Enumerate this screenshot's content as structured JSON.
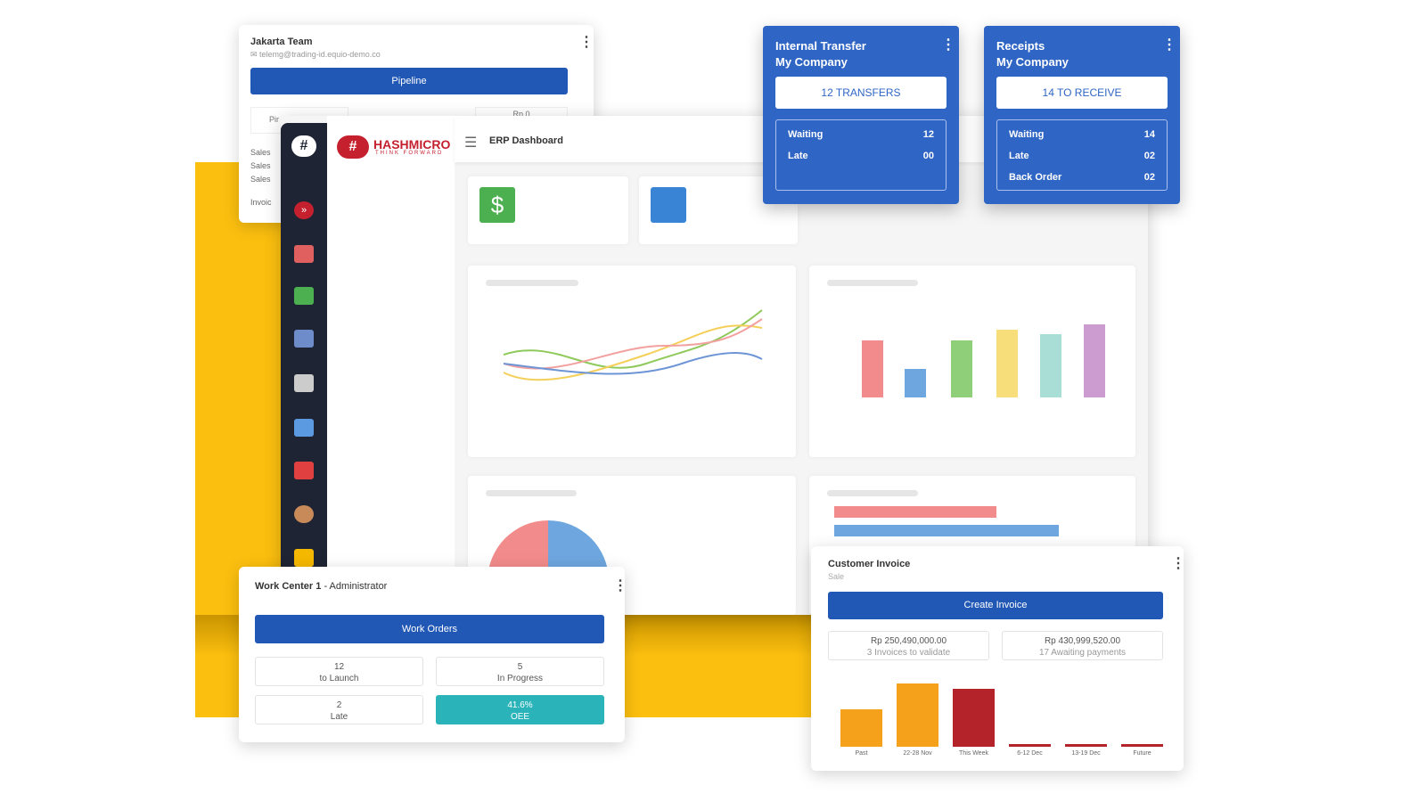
{
  "jakarta": {
    "title": "Jakarta Team",
    "email": "telemg@trading-id.equio-demo.co",
    "button": "Pipeline",
    "tab1": "Pir",
    "tab3": "Rp 0",
    "rows": [
      "Sales",
      "Sales",
      "Sales"
    ],
    "invoice": "Invoic"
  },
  "dashboard": {
    "brand": "HASHMICRO",
    "tagline": "THINK FORWARD",
    "title": "ERP Dashboard"
  },
  "transfer": {
    "title": "Internal Transfer",
    "company": "My Company",
    "button": "12 TRANSFERS",
    "rows": [
      {
        "label": "Waiting",
        "value": "12"
      },
      {
        "label": "Late",
        "value": "00"
      }
    ]
  },
  "receipts": {
    "title": "Receipts",
    "company": "My Company",
    "button": "14 TO RECEIVE",
    "rows": [
      {
        "label": "Waiting",
        "value": "14"
      },
      {
        "label": "Late",
        "value": "02"
      },
      {
        "label": "Back Order",
        "value": "02"
      }
    ]
  },
  "workcenter": {
    "title": "Work Center 1",
    "role": "- Administrator",
    "button": "Work Orders",
    "stats": [
      {
        "value": "12",
        "label": "to Launch"
      },
      {
        "value": "5",
        "label": "In Progress"
      },
      {
        "value": "2",
        "label": "Late"
      },
      {
        "value": "41.6%",
        "label": "OEE"
      }
    ]
  },
  "invoice": {
    "title": "Customer Invoice",
    "subtitle": "Sale",
    "button": "Create Invoice",
    "stats": [
      {
        "value": "Rp 250,490,000.00",
        "label": "3 Invoices to validate"
      },
      {
        "value": "Rp 430,999,520.00",
        "label": "17 Awaiting payments"
      }
    ]
  },
  "chart_data": {
    "type": "bar",
    "categories": [
      "Past",
      "22-28 Nov",
      "This Week",
      "6-12 Dec",
      "13-19 Dec",
      "Future"
    ],
    "values": [
      37,
      62,
      57,
      3,
      3,
      3
    ],
    "colors": [
      "#f5a11c",
      "#f5a11c",
      "#b5232a",
      "#b5232a",
      "#b5232a",
      "#b5232a"
    ]
  },
  "colors": {
    "accent": "#2158b5",
    "yellow": "#fbbf0f",
    "teal": "#2ab3b8",
    "sidebar": "#1e2433"
  }
}
